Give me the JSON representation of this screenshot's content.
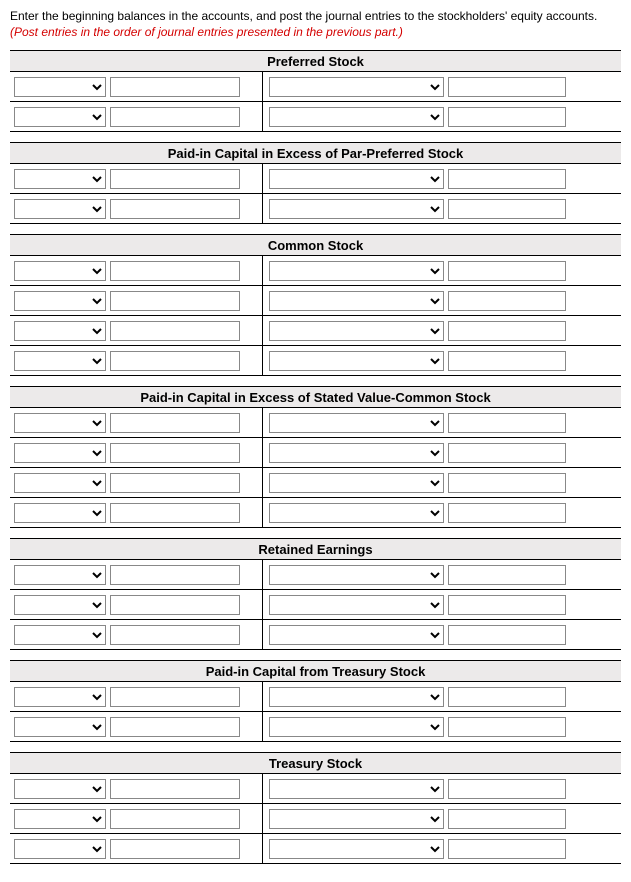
{
  "instructions": {
    "main": "Enter the beginning balances in the accounts, and post the journal entries to the stockholders' equity accounts. ",
    "note": "(Post entries in the order of journal entries presented in the previous part.)"
  },
  "accounts": [
    {
      "title": "Preferred Stock",
      "rows": 2
    },
    {
      "title": "Paid-in Capital in Excess of Par-Preferred Stock",
      "rows": 2
    },
    {
      "title": "Common Stock",
      "rows": 4
    },
    {
      "title": "Paid-in Capital in Excess of Stated Value-Common Stock",
      "rows": 4
    },
    {
      "title": "Retained Earnings",
      "rows": 3
    },
    {
      "title": "Paid-in Capital from Treasury Stock",
      "rows": 2
    },
    {
      "title": "Treasury Stock",
      "rows": 3
    }
  ]
}
